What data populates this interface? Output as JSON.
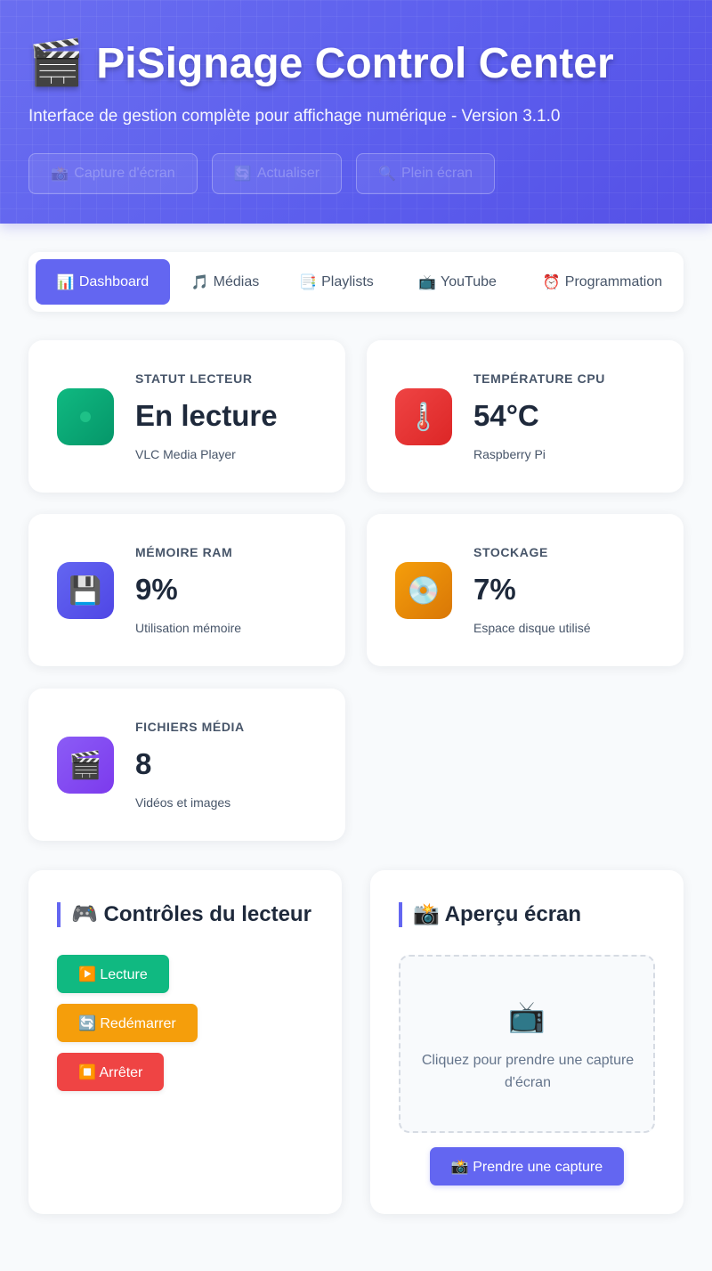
{
  "header": {
    "title_icon": "🎬",
    "title": "PiSignage Control Center",
    "subtitle": "Interface de gestion complète pour affichage numérique - Version 3.1.0",
    "buttons": [
      {
        "icon": "📸",
        "label": "Capture d'écran"
      },
      {
        "icon": "🔄",
        "label": "Actualiser"
      },
      {
        "icon": "🔍",
        "label": "Plein écran"
      }
    ]
  },
  "tabs": [
    {
      "icon": "📊",
      "label": "Dashboard",
      "active": true
    },
    {
      "icon": "🎵",
      "label": "Médias"
    },
    {
      "icon": "📑",
      "label": "Playlists"
    },
    {
      "icon": "📺",
      "label": "YouTube"
    },
    {
      "icon": "⏰",
      "label": "Programmation"
    }
  ],
  "stats": [
    {
      "icon": "status-dot-icon",
      "glyph": "●",
      "label": "Statut Lecteur",
      "value": "En lecture",
      "sub": "VLC Media Player",
      "color": "#10b981"
    },
    {
      "icon": "thermometer-icon",
      "glyph": "🌡️",
      "label": "Température CPU",
      "value": "54°C",
      "sub": "Raspberry Pi",
      "color": "#ef4444"
    },
    {
      "icon": "floppy-disk-icon",
      "glyph": "💾",
      "label": "Mémoire RAM",
      "value": "9%",
      "sub": "Utilisation mémoire",
      "color": "#6366f1"
    },
    {
      "icon": "disc-icon",
      "glyph": "💿",
      "label": "Stockage",
      "value": "7%",
      "sub": "Espace disque utilisé",
      "color": "#f59e0b"
    },
    {
      "icon": "clapperboard-icon",
      "glyph": "🎬",
      "label": "Fichiers Média",
      "value": "8",
      "sub": "Vidéos et images",
      "color": "#8b5cf6"
    }
  ],
  "controls": {
    "title": "🎮 Contrôles du lecteur",
    "buttons": [
      {
        "label": "▶️ Lecture",
        "color": "#10b981"
      },
      {
        "label": "🔄 Redémarrer",
        "color": "#f59e0b"
      },
      {
        "label": "⏹️ Arrêter",
        "color": "#ef4444"
      }
    ]
  },
  "preview": {
    "title": "📸 Aperçu écran",
    "icon": "📺",
    "placeholder": "Cliquez pour prendre une capture d'écran",
    "button": "📸 Prendre une capture"
  }
}
